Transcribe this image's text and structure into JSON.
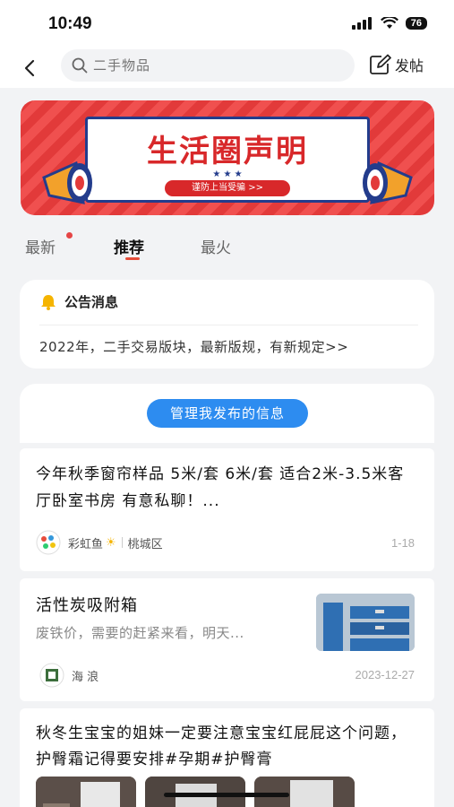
{
  "status": {
    "time": "10:49",
    "battery": "76"
  },
  "nav": {
    "search_placeholder": "二手物品",
    "post_label": "发帖"
  },
  "banner": {
    "title": "生活圈声明",
    "stars": "★ ★ ★",
    "subtitle": "谨防上当受骗 >>"
  },
  "tabs": [
    {
      "label": "最新",
      "has_dot": true
    },
    {
      "label": "推荐",
      "active": true
    },
    {
      "label": "最火"
    }
  ],
  "notice": {
    "heading": "公告消息",
    "text": "2022年，二手交易版块，最新版规，有新规定>>"
  },
  "manage_button": "管理我发布的信息",
  "posts": [
    {
      "title": "今年秋季窗帘样品 5米/套 6米/套 适合2米-3.5米客厅卧室书房 有意私聊！...",
      "author": "彩虹鱼",
      "author_badge": "☀",
      "location": "桃城区",
      "date": "1-18"
    },
    {
      "title": "活性炭吸附箱",
      "desc": "废铁价，需要的赶紧来看，明天...",
      "author": "海 浪",
      "date": "2023-12-27"
    },
    {
      "title": "秋冬生宝宝的姐妹一定要注意宝宝红屁屁这个问题，护臀霜记得要安排#孕期#护臀膏"
    }
  ],
  "colors": {
    "accent_blue": "#2d8cf0",
    "brand_red": "#e23a3a",
    "tab_underline": "#e54d3a"
  }
}
